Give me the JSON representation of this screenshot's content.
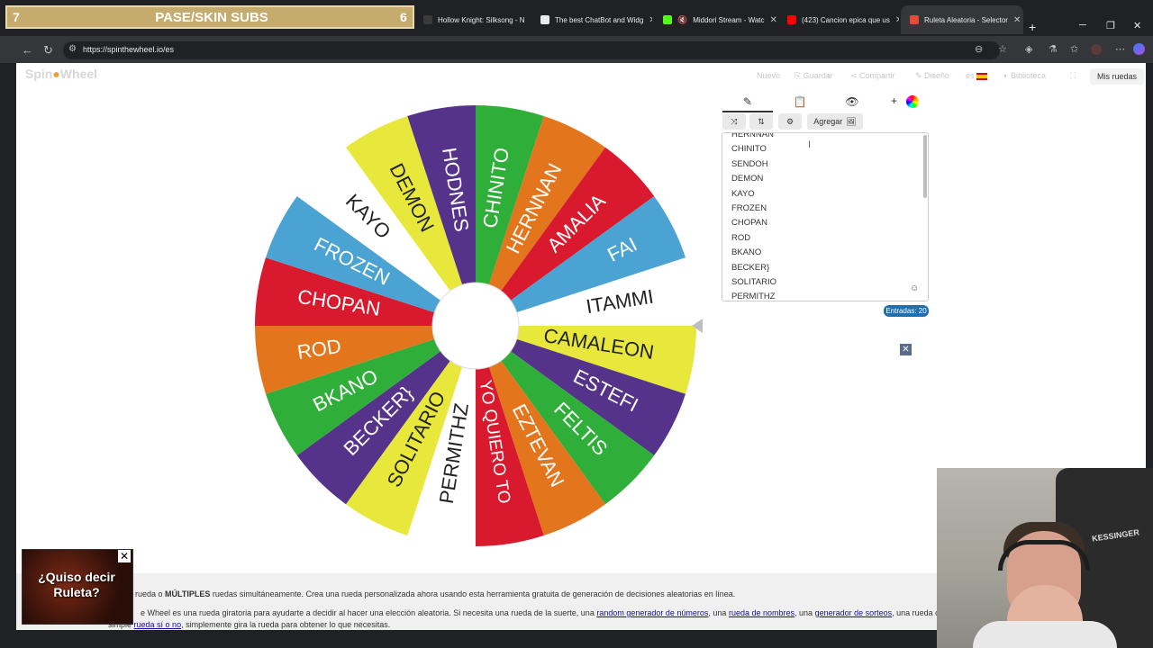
{
  "overlay": {
    "left_value": "7",
    "title": "PASE/SKIN SUBS",
    "right_value": "6"
  },
  "tabs": [
    {
      "label": "Hollow Knight: Silksong - N",
      "favicon": "#3a3a3a"
    },
    {
      "label": "The best ChatBot and Widg",
      "favicon": "#e8eaed"
    },
    {
      "label": "Middori Stream - Watc",
      "favicon": "#53fc18"
    },
    {
      "label": "(423) Cancion epica que us",
      "favicon": "#ff0000"
    },
    {
      "label": "Ruleta Aleatoria - Selector",
      "favicon": "#e44b3c"
    }
  ],
  "address": {
    "url": "https://spinthewheel.io/es"
  },
  "site": {
    "logo_prefix": "Spin",
    "logo_suffix": "Wheel",
    "menu": [
      "Nuevo",
      "Guardar",
      "Compartir",
      "Diseño",
      "es",
      "Biblioteca"
    ],
    "my_wheels": "Mis ruedas"
  },
  "editor": {
    "add_label": "Agregar",
    "entries": [
      "HERNNAN",
      "CHINITO",
      "SENDOH",
      "DEMON",
      "KAYO",
      "FROZEN",
      "CHOPAN",
      "ROD",
      "BKANO",
      "BECKER}",
      "SOLITARIO",
      "PERMITHZ"
    ],
    "count_label": "Entradas: 20"
  },
  "wheel": {
    "slices": [
      {
        "label": "FAI",
        "color": "#4ba3d3",
        "text_color": "#ffffff"
      },
      {
        "label": "ITAMMI",
        "color": "#ffffff",
        "text_color": "#222222"
      },
      {
        "label": "CAMALEON",
        "color": "#e8e83c",
        "text_color": "#222222"
      },
      {
        "label": "ESTEFI",
        "color": "#55338a",
        "text_color": "#ffffff"
      },
      {
        "label": "FELTIS",
        "color": "#2fae3a",
        "text_color": "#ffffff"
      },
      {
        "label": "EZTEVAN",
        "color": "#e3761c",
        "text_color": "#ffffff"
      },
      {
        "label": "YO QUIERO TO",
        "color": "#d9192d",
        "text_color": "#ffffff"
      },
      {
        "label": "PERMITHZ",
        "color": "#ffffff",
        "text_color": "#222222"
      },
      {
        "label": "SOLITARIO",
        "color": "#e8e83c",
        "text_color": "#222222"
      },
      {
        "label": "BECKER}",
        "color": "#55338a",
        "text_color": "#ffffff"
      },
      {
        "label": "BKANO",
        "color": "#2fae3a",
        "text_color": "#ffffff"
      },
      {
        "label": "ROD",
        "color": "#e3761c",
        "text_color": "#ffffff"
      },
      {
        "label": "CHOPAN",
        "color": "#d9192d",
        "text_color": "#ffffff"
      },
      {
        "label": "FROZEN",
        "color": "#4ba3d3",
        "text_color": "#ffffff"
      },
      {
        "label": "KAYO",
        "color": "#ffffff",
        "text_color": "#222222"
      },
      {
        "label": "DEMON",
        "color": "#e8e83c",
        "text_color": "#222222"
      },
      {
        "label": "HODNES",
        "color": "#55338a",
        "text_color": "#ffffff"
      },
      {
        "label": "CHINITO",
        "color": "#2fae3a",
        "text_color": "#ffffff"
      },
      {
        "label": "HERNNAN",
        "color": "#e3761c",
        "text_color": "#ffffff"
      },
      {
        "label": "AMALIA",
        "color": "#d9192d",
        "text_color": "#ffffff"
      }
    ]
  },
  "description": {
    "line1_a": "rueda o",
    "line1_b": "MÚLTIPLES",
    "line1_c": "ruedas simultáneamente. Crea una rueda personalizada ahora usando esta herramienta gratuita de generación de decisiones aleatorias en línea.",
    "line2_a": "e Wheel es una rueda giratoria para ayudarte a decidir al hacer una elección aleatoria. Si necesita una rueda de la suerte, una",
    "line2_link1": "random generador de números",
    "line2_b": ", una",
    "line2_link2": "rueda de nombres",
    "line2_c": ", una",
    "line2_link3": "generador de sorteos",
    "line2_d": ", una rueda o",
    "line3_a": "simple",
    "line3_link": "rueda sí o no",
    "line3_b": ", simplemente gira la rueda para obtener lo que necesitas."
  },
  "ad": {
    "text": "¿Quiso decir Ruleta?"
  },
  "webcam": {
    "chair_text": "KESSINGER"
  }
}
